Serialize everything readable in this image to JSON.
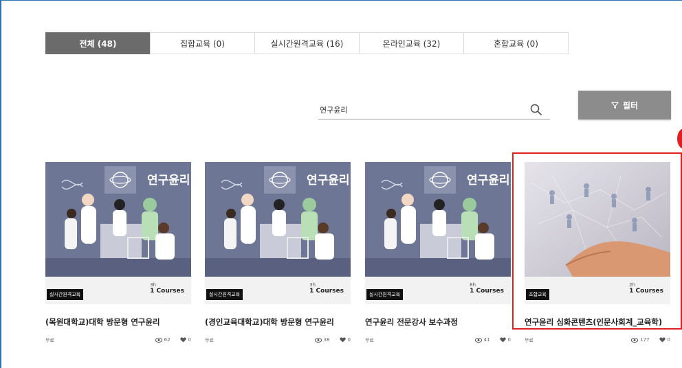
{
  "tabs": [
    {
      "label": "전체 (48)",
      "active": true
    },
    {
      "label": "집합교육 (0)",
      "active": false
    },
    {
      "label": "실시간원격교육 (16)",
      "active": false
    },
    {
      "label": "온라인교육 (32)",
      "active": false
    },
    {
      "label": "혼합교육 (0)",
      "active": false
    }
  ],
  "search": {
    "value": "연구윤리",
    "icon": "search-icon"
  },
  "filter": {
    "label": "필터",
    "icon": "filter-icon"
  },
  "colors": {
    "active_tab": "#6b6b6b",
    "filter_button": "#8c8c8c",
    "highlight": "#e01f1f",
    "thumb_bg": "#6e7695"
  },
  "thumbnail_text": "연구윤리",
  "cards": [
    {
      "badge": "실시간원격교육",
      "duration": "3h",
      "courses": "1 Courses",
      "title": "(목원대학교)대학 방문형 연구윤리",
      "price": "무료",
      "views": "62",
      "likes": "0"
    },
    {
      "badge": "실시간원격교육",
      "duration": "3h",
      "courses": "1 Courses",
      "title": "(경인교육대학교)대학 방문형 연구윤리",
      "price": "무료",
      "views": "38",
      "likes": "0"
    },
    {
      "badge": "실시간원격교육",
      "duration": "8h",
      "courses": "1 Courses",
      "title": "연구윤리 전문강사 보수과정",
      "price": "무료",
      "views": "41",
      "likes": "0"
    },
    {
      "badge": "조합교육",
      "duration": "2h",
      "courses": "1 Courses",
      "title": "연구윤리 심화콘텐츠(인문사회계_교육학)",
      "price": "무료",
      "views": "177",
      "likes": "0"
    }
  ]
}
